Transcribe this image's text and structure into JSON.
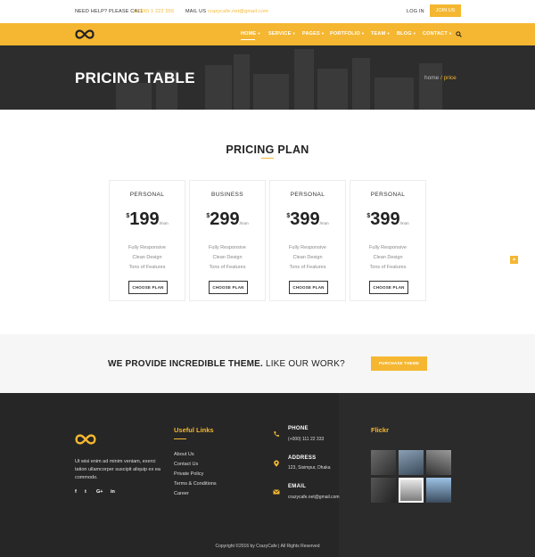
{
  "topbar": {
    "help_label": "NEED HELP? PLEASE CALL",
    "help_phone": "(+000) 1 222 555",
    "mail_label": "MAIL US",
    "mail_value": "crazycafe.net@gmail.com",
    "login_label": "LOG IN",
    "join_label": "JOIN US"
  },
  "nav": {
    "items": [
      {
        "label": "HOME"
      },
      {
        "label": "SERVICE"
      },
      {
        "label": "PAGES"
      },
      {
        "label": "PORTFOLIO"
      },
      {
        "label": "TEAM"
      },
      {
        "label": "BLOG"
      },
      {
        "label": "CONTACT"
      }
    ],
    "search_icon": "search-icon",
    "logo_icon": "infinity-logo"
  },
  "hero": {
    "title": "PRICING TABLE",
    "crumb_home": "home",
    "crumb_current": "/ price"
  },
  "pricing": {
    "title": "PRICING PLAN",
    "plans": [
      {
        "name": "PERSONAL",
        "currency": "$",
        "amount": "199",
        "period": "/mon",
        "features": [
          "Fully Responsive",
          "Clean Design",
          "Tons of Features"
        ],
        "button": "CHOOSE PLAN"
      },
      {
        "name": "BUSINESS",
        "currency": "$",
        "amount": "299",
        "period": "/mon",
        "features": [
          "Fully Responsive",
          "Clean Design",
          "Tons of Features"
        ],
        "button": "CHOOSE PLAN"
      },
      {
        "name": "PERSONAL",
        "currency": "$",
        "amount": "399",
        "period": "/mon",
        "features": [
          "Fully Responsive",
          "Clean Design",
          "Tons of Features"
        ],
        "button": "CHOOSE PLAN"
      },
      {
        "name": "PERSONAL",
        "currency": "$",
        "amount": "399",
        "period": "/mon",
        "features": [
          "Fully Responsive",
          "Clean Design",
          "Tons of Features"
        ],
        "button": "CHOOSE PLAN"
      }
    ]
  },
  "cta": {
    "text_bold": "WE PROVIDE INCREDIBLE THEME.",
    "text_normal": "LIKE OUR WORK?",
    "button": "PURCHASE THEME"
  },
  "footer": {
    "about": "Ut wisi enim ad minim veniam, exerci tation ullamcorper suscipit aliquip ex ea commodo.",
    "social": [
      "f",
      "t",
      "G+",
      "in"
    ],
    "links_title": "Useful Links",
    "links": [
      "About Us",
      "Contact Us",
      "Private Policy",
      "Terms & Conditions",
      "Career"
    ],
    "phone_label": "PHONE",
    "phone_value": "(+000) 111 22 333",
    "address_label": "ADDRESS",
    "address_value": "123, Sisimpur, Dhaka",
    "email_label": "EMAIL",
    "email_value": "crazycafe.net@gmail.com",
    "flickr_title": "Flickr",
    "copyright": "Copyright ©2016 by CrazyCafe  |  All Rights Reserved"
  },
  "colors": {
    "accent": "#f5b731",
    "dark": "#262626",
    "hero": "#2d2d2d"
  }
}
